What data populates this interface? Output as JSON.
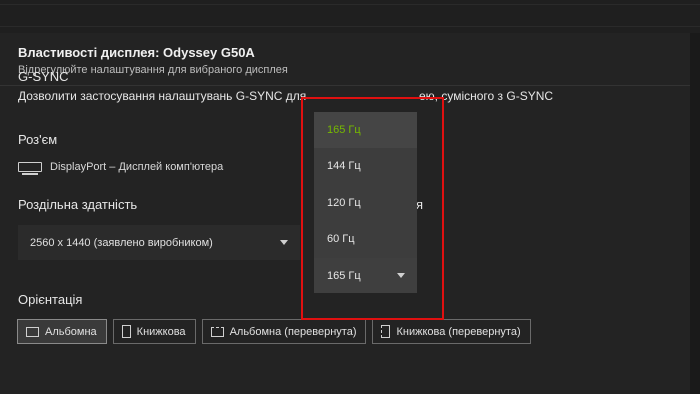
{
  "panel": {
    "title": "Властивості дисплея: Odyssey G50A",
    "subtitle": "Відрегулюйте налаштування для вибраного дисплея"
  },
  "gsync": {
    "label": "G-SYNC",
    "description": "Дозволити застосування налаштувань G-SYNC для",
    "description_tail": "ею, сумісного з G-SYNC"
  },
  "connector": {
    "label": "Роз'єм",
    "icon": "displayport-icon",
    "value": "DisplayPort – Дисплей комп'ютера"
  },
  "resolution": {
    "label": "Роздільна здатність",
    "value": "2560 x 1440 (заявлено виробником)"
  },
  "refresh_rate": {
    "label_tail": "я",
    "selected": "165 Гц",
    "options": [
      "165 Гц",
      "144 Гц",
      "120 Гц",
      "60 Гц"
    ],
    "accent_color": "#76b900"
  },
  "orientation": {
    "label": "Орієнтація",
    "buttons": [
      {
        "label": "Альбомна",
        "icon": "landscape-icon",
        "active": true
      },
      {
        "label": "Книжкова",
        "icon": "portrait-icon",
        "active": false
      },
      {
        "label": "Альбомна (перевернута)",
        "icon": "landscape-flipped-icon",
        "active": false
      },
      {
        "label": "Книжкова (перевернута)",
        "icon": "portrait-flipped-icon",
        "active": false
      }
    ]
  },
  "highlight_color": "#e01010"
}
